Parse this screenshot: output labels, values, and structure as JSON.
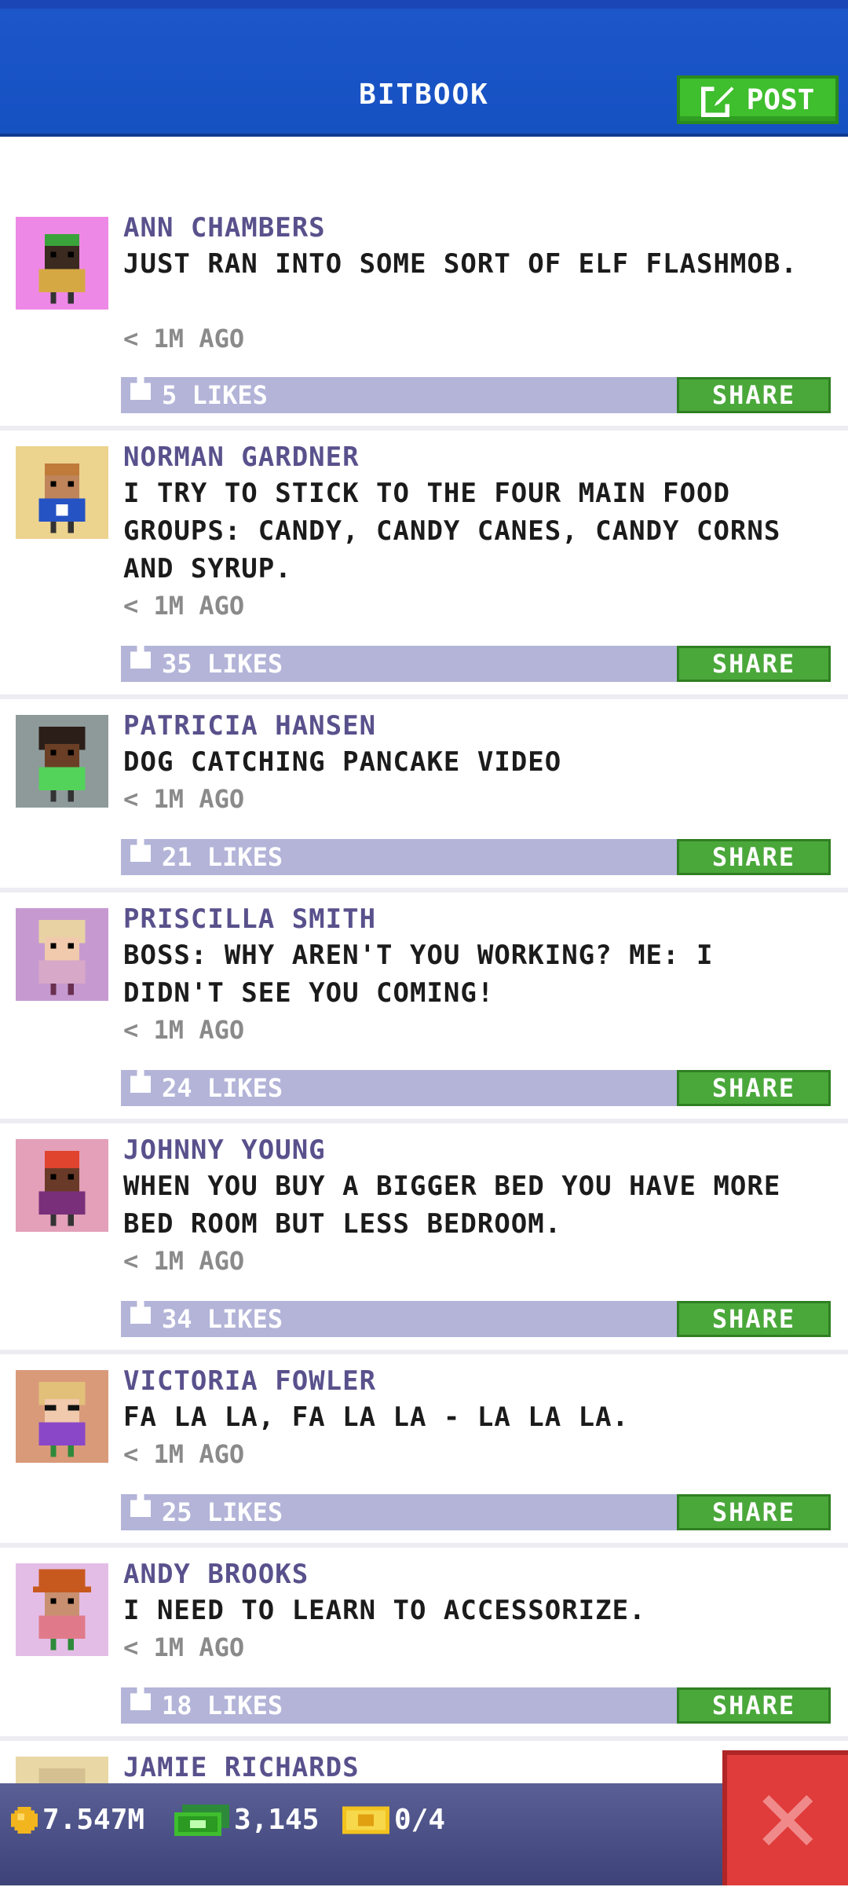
{
  "header": {
    "title": "BITBOOK",
    "post_label": "POST"
  },
  "posts": [
    {
      "name": "ANN CHAMBERS",
      "text": "JUST RAN INTO SOME SORT OF ELF FLASHMOB.",
      "time": "< 1M AGO",
      "likes": "5 LIKES",
      "share": "SHARE",
      "avatar_bg": "#ee88e6"
    },
    {
      "name": "NORMAN GARDNER",
      "text": "I TRY TO STICK TO THE FOUR MAIN FOOD GROUPS: CANDY, CANDY CANES, CANDY CORNS AND SYRUP.",
      "time": "< 1M AGO",
      "likes": "35 LIKES",
      "share": "SHARE",
      "avatar_bg": "#ecd38e"
    },
    {
      "name": "PATRICIA HANSEN",
      "text": "DOG CATCHING PANCAKE VIDEO",
      "time": "< 1M AGO",
      "likes": "21 LIKES",
      "share": "SHARE",
      "avatar_bg": "#8e9a9a"
    },
    {
      "name": "PRISCILLA SMITH",
      "text": "BOSS: WHY AREN'T YOU WORKING? ME: I DIDN'T SEE YOU COMING!",
      "time": "< 1M AGO",
      "likes": "24 LIKES",
      "share": "SHARE",
      "avatar_bg": "#c69ad0"
    },
    {
      "name": "JOHNNY YOUNG",
      "text": "WHEN YOU BUY A BIGGER BED YOU HAVE MORE BED ROOM BUT LESS BEDROOM.",
      "time": "< 1M AGO",
      "likes": "34 LIKES",
      "share": "SHARE",
      "avatar_bg": "#e3a0b8"
    },
    {
      "name": "VICTORIA FOWLER",
      "text": "FA LA LA, FA LA LA - LA LA LA.",
      "time": "< 1M AGO",
      "likes": "25 LIKES",
      "share": "SHARE",
      "avatar_bg": "#d99a7a"
    },
    {
      "name": "ANDY BROOKS",
      "text": "I NEED TO LEARN TO ACCESSORIZE.",
      "time": "< 1M AGO",
      "likes": "18 LIKES",
      "share": "SHARE",
      "avatar_bg": "#e4bde6"
    },
    {
      "name": "JAMIE RICHARDS",
      "avatar_bg": "#e9d8a6"
    }
  ],
  "status": {
    "coins": "7.547M",
    "bux": "3,145",
    "tickets": "0/4"
  },
  "icons": {
    "post": "edit-icon",
    "like": "thumb-up-icon",
    "coins": "coin-icon",
    "bux": "bux-icon",
    "tickets": "ticket-icon",
    "close": "close-icon"
  }
}
